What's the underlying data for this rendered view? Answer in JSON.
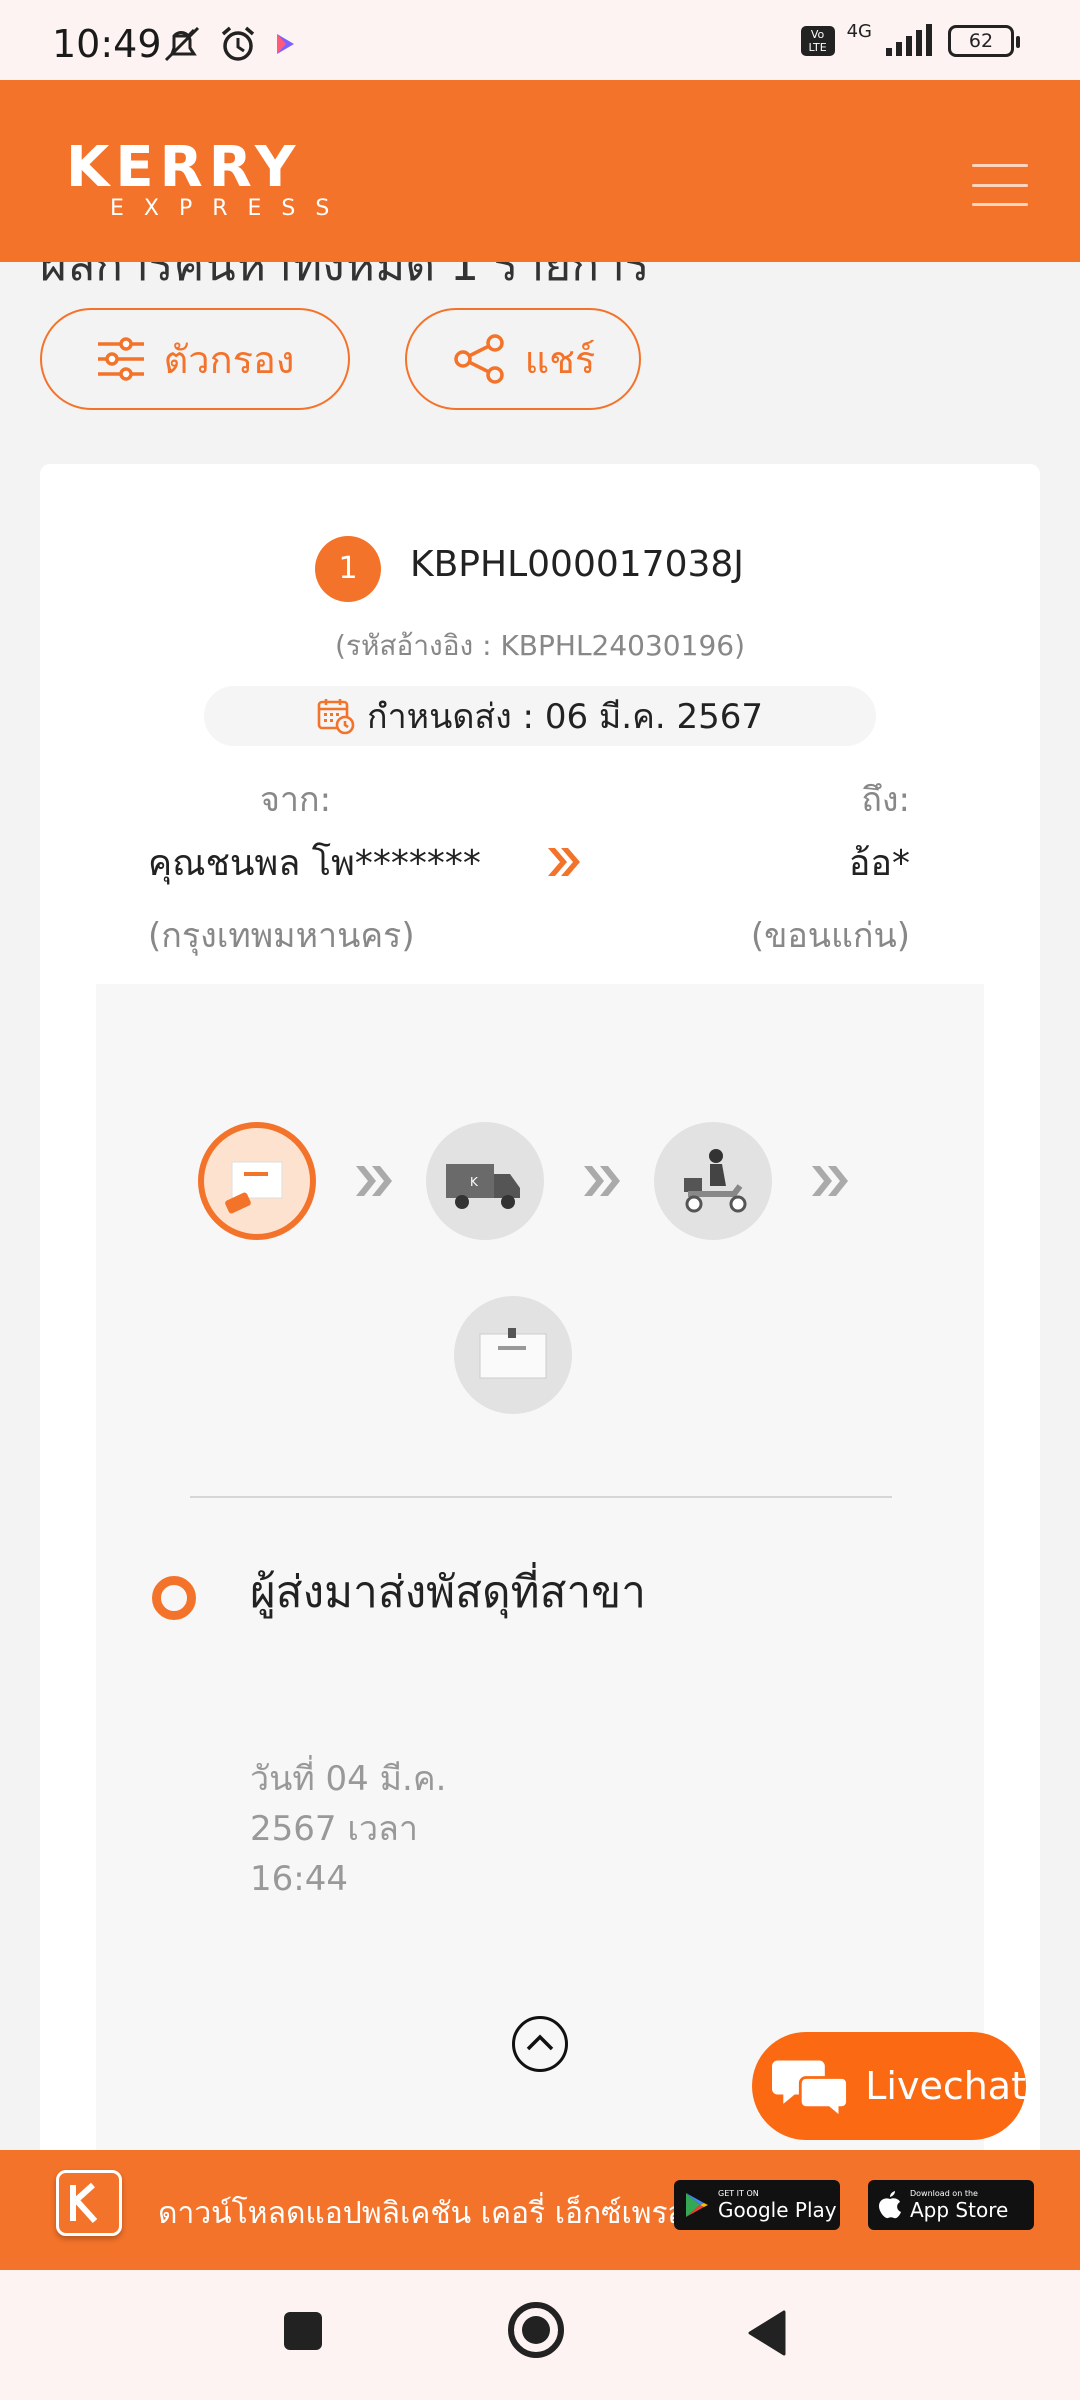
{
  "status_bar": {
    "time": "10:49",
    "network": "4G",
    "volte": "Vo LTE",
    "battery": "62"
  },
  "header": {
    "logo_main": "KERRY",
    "logo_sub": "EXPRESS"
  },
  "results": {
    "title": "ผลการค้นหาทั้งหมด 1 รายการ",
    "filter_label": "ตัวกรอง",
    "share_label": "แชร์"
  },
  "parcel": {
    "index": "1",
    "tracking_no": "KBPHL000017038J",
    "reference": "(รหัสอ้างอิง : KBPHL24030196)",
    "due_date": "กำหนดส่ง : 06 มี.ค. 2567",
    "from_label": "จาก:",
    "to_label": "ถึง:",
    "from_name": "คุณชนพล โพ*******",
    "to_name": "อ้อ*",
    "from_city": "(กรุงเทพมหานคร)",
    "to_city": "(ขอนแก่น)"
  },
  "steps": [
    {
      "icon": "parcel-box-icon",
      "active": true
    },
    {
      "icon": "delivery-truck-icon",
      "active": false
    },
    {
      "icon": "delivery-scooter-icon",
      "active": false
    },
    {
      "icon": "delivered-box-icon",
      "active": false
    }
  ],
  "event": {
    "title": "ผู้ส่งมาส่งพัสดุที่สาขา",
    "time": "วันที่ 04 มี.ค. 2567 เวลา 16:44"
  },
  "livechat": {
    "label": "Livechat"
  },
  "banner": {
    "text": "ดาวน์โหลดแอปพลิเคชัน เคอรี่ เอ็กซ์เพรส",
    "google_small": "GET IT ON",
    "google_big": "Google Play",
    "apple_small": "Download on the",
    "apple_big": "App Store"
  },
  "colors": {
    "brand": "#f4732a",
    "livechat": "#fb6a12"
  }
}
